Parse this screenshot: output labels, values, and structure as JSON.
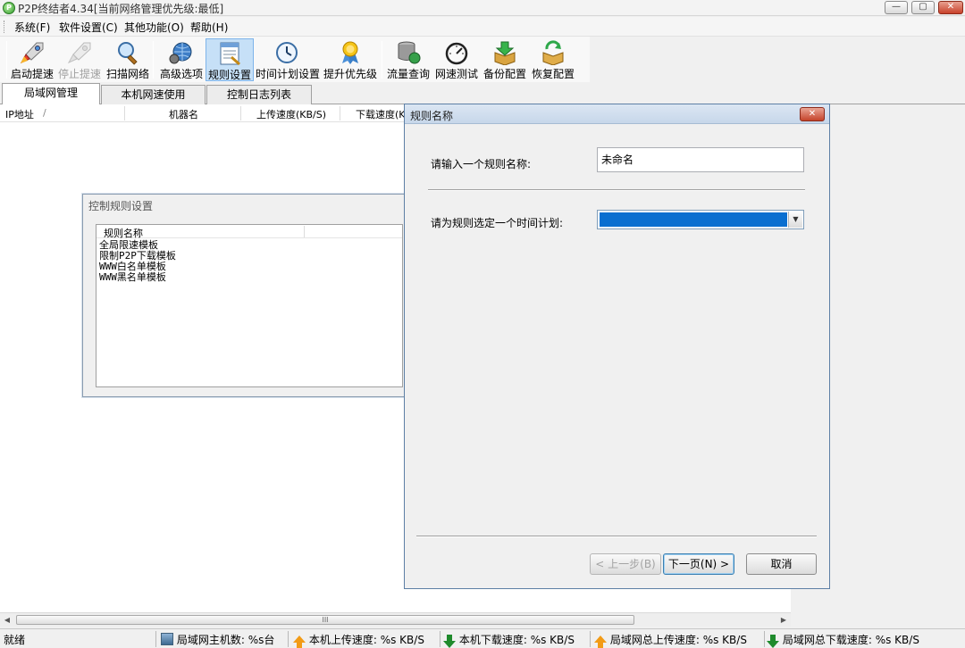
{
  "window": {
    "title": "P2P终结者4.34[当前网络管理优先级:最低]",
    "icon_letter": "P"
  },
  "menu": [
    "系统(F)",
    "软件设置(C)",
    "其他功能(O)",
    "帮助(H)"
  ],
  "toolbar": {
    "items": [
      {
        "label": "启动提速",
        "icon": "rocket-icon",
        "state": "normal"
      },
      {
        "label": "停止提速",
        "icon": "rocket-disabled-icon",
        "state": "disabled"
      },
      {
        "label": "扫描网络",
        "icon": "magnifier-icon",
        "state": "normal"
      },
      {
        "label": "高级选项",
        "icon": "globe-tools-icon",
        "state": "normal"
      },
      {
        "label": "规则设置",
        "icon": "rules-document-icon",
        "state": "selected"
      },
      {
        "label": "时间计划设置",
        "icon": "clock-icon",
        "state": "normal"
      },
      {
        "label": "提升优先级",
        "icon": "award-medal-icon",
        "state": "normal"
      },
      {
        "label": "流量查询",
        "icon": "database-globe-icon",
        "state": "normal"
      },
      {
        "label": "网速测试",
        "icon": "speedometer-icon",
        "state": "normal"
      },
      {
        "label": "备份配置",
        "icon": "box-down-arrow-icon",
        "state": "normal"
      },
      {
        "label": "恢复配置",
        "icon": "box-refresh-icon",
        "state": "normal"
      }
    ]
  },
  "tabs": [
    "局域网管理",
    "本机网速使用",
    "控制日志列表"
  ],
  "table": {
    "columns": [
      "IP地址",
      "机器名",
      "上传速度(KB/S)",
      "下载速度(K"
    ],
    "sort_indicator": "/"
  },
  "scrollbar": {
    "thumb_grip": "III"
  },
  "statusbar": {
    "status": "就绪",
    "hosts_label": "局域网主机数:",
    "hosts_value": "%s台",
    "local_up_label": "本机上传速度:",
    "local_up_value": "%s KB/S",
    "local_down_label": "本机下载速度:",
    "local_down_value": "%s KB/S",
    "lan_up_label": "局域网总上传速度:",
    "lan_up_value": "%s KB/S",
    "lan_down_label": "局域网总下载速度:",
    "lan_down_value": "%s KB/S"
  },
  "rule_dialog": {
    "title": "控制规则设置",
    "list_header": "规则名称",
    "rules": [
      "全局限速模板",
      "限制P2P下载模板",
      "WWW白名单模板",
      "WWW黑名单模板"
    ]
  },
  "name_dialog": {
    "title": "规则名称",
    "name_label": "请输入一个规则名称:",
    "name_value": "未命名",
    "schedule_label": "请为规则选定一个时间计划:",
    "schedule_value": "",
    "prev_button": "< 上一步(B)",
    "next_button": "下一页(N) >",
    "cancel_button": "取消",
    "selection_color": "#0a6fd0"
  }
}
